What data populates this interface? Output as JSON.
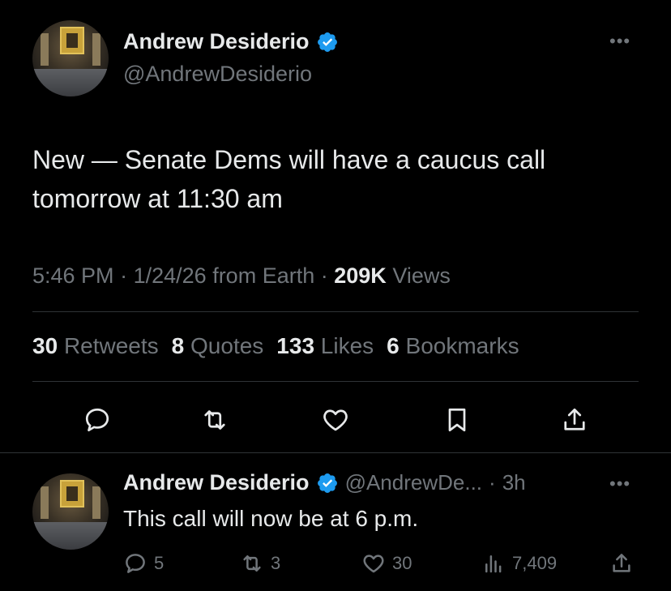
{
  "main_tweet": {
    "author_name": "Andrew Desiderio",
    "author_handle": "@AndrewDesiderio",
    "more_label": "•••",
    "text_line1": "New — Senate Dems will have a caucus call",
    "text_line2": "tomorrow at 11:30 am",
    "time": "5:46 PM",
    "date": "1/24/26",
    "source": "from Earth",
    "views_count": "209K",
    "views_label": "Views",
    "stats": {
      "retweets_count": "30",
      "retweets_label": "Retweets",
      "quotes_count": "8",
      "quotes_label": "Quotes",
      "likes_count": "133",
      "likes_label": "Likes",
      "bookmarks_count": "6",
      "bookmarks_label": "Bookmarks"
    },
    "actions": [
      "reply-icon",
      "retweet-icon",
      "like-icon",
      "bookmark-icon",
      "share-icon"
    ]
  },
  "reply_tweet": {
    "author_name": "Andrew Desiderio",
    "author_handle": "@AndrewDe...",
    "time_ago": "3h",
    "more_label": "•••",
    "text": "This call will now be at 6 p.m.",
    "replies": "5",
    "retweets": "3",
    "likes": "30",
    "views": "7,409"
  },
  "colors": {
    "background": "#000000",
    "text": "#e7e9ea",
    "secondary": "#71767b",
    "divider": "#2f3336",
    "verified": "#1d9bf0"
  }
}
